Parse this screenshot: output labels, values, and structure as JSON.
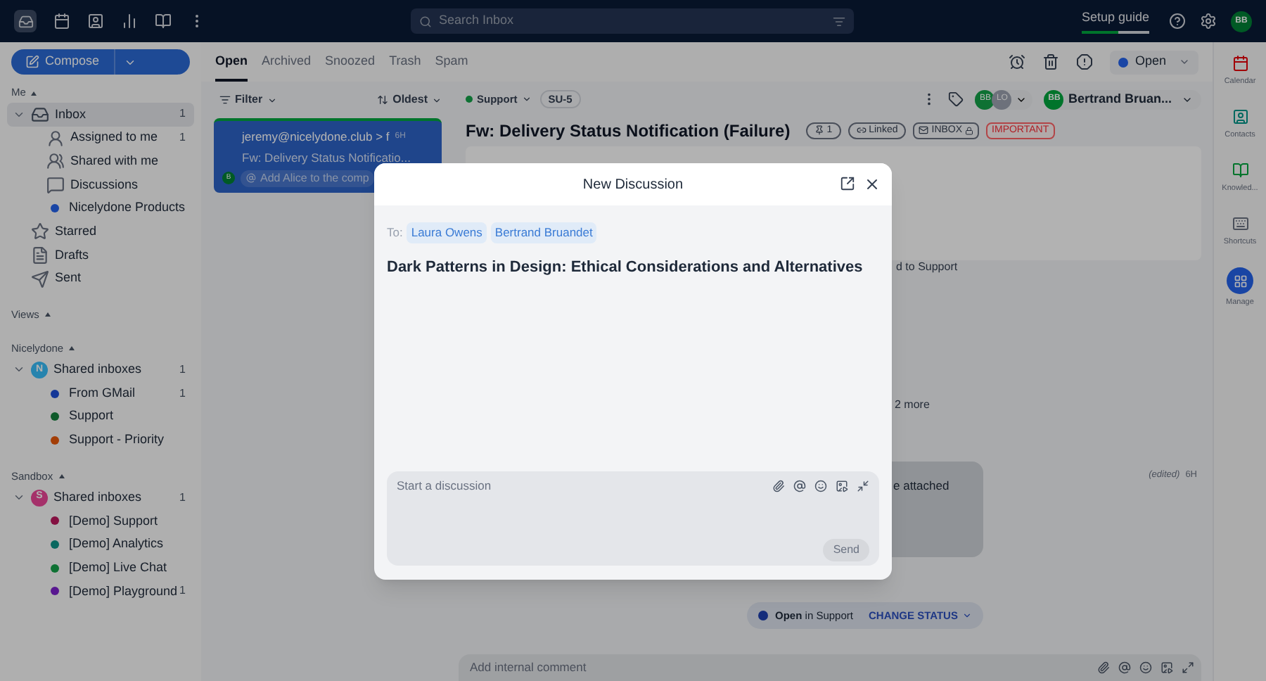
{
  "top_bar": {
    "search": {
      "placeholder": "Search Inbox"
    },
    "setup_guide": {
      "label": "Setup guide",
      "level": 0.55
    },
    "avatar": "BB"
  },
  "sidebar": {
    "compose": "Compose",
    "sections": [
      {
        "title": "Me",
        "items": [
          {
            "kind": "inbox",
            "label": "Inbox",
            "count": "1",
            "selected": true,
            "expanded": true,
            "children": [
              {
                "kind": "person",
                "label": "Assigned to me",
                "count": "1",
                "selected": false
              },
              {
                "kind": "people",
                "label": "Shared with me",
                "selected": false
              },
              {
                "kind": "chat",
                "label": "Discussions",
                "selected": false
              },
              {
                "kind": "dot",
                "label": "Nicelydone Products",
                "color": "#1a45a5",
                "selected": false
              }
            ]
          },
          {
            "kind": "star",
            "label": "Starred",
            "selected": false
          },
          {
            "kind": "draft",
            "label": "Drafts",
            "selected": false
          },
          {
            "kind": "send",
            "label": "Sent",
            "selected": false
          }
        ]
      },
      {
        "title": "Views"
      },
      {
        "title": "Nicelydone",
        "items": [
          {
            "kind": "group",
            "badge": "N",
            "color": "#2784ae",
            "label": "Shared inboxes",
            "count": "1",
            "selected": false,
            "expanded": true,
            "children": [
              {
                "kind": "dot",
                "label": "From GMail",
                "count": "1",
                "color": "#143797",
                "selected": false
              },
              {
                "kind": "dot",
                "label": "Support",
                "color": "#0f5a2b",
                "selected": false
              },
              {
                "kind": "dot",
                "label": "Support - Priority",
                "color": "#a43e08",
                "selected": false
              }
            ]
          }
        ]
      },
      {
        "title": "Sandbox",
        "items": [
          {
            "kind": "group",
            "badge": "S",
            "color": "#a5326b",
            "label": "Shared inboxes",
            "count": "1",
            "selected": false,
            "expanded": true,
            "children": [
              {
                "kind": "dot",
                "label": "[Demo] Support",
                "color": "#851141",
                "selected": false
              },
              {
                "kind": "dot",
                "label": "[Demo] Analytics",
                "color": "#09685f",
                "selected": false
              },
              {
                "kind": "dot",
                "label": "[Demo] Live Chat",
                "color": "#0f7234",
                "selected": false
              },
              {
                "kind": "dot",
                "label": "[Demo] Playground",
                "count": "1",
                "color": "#581890",
                "selected": false
              }
            ]
          }
        ]
      }
    ]
  },
  "tabs": [
    {
      "label": "Open",
      "selected": true
    },
    {
      "label": "Archived",
      "selected": false
    },
    {
      "label": "Snoozed",
      "selected": false
    },
    {
      "label": "Trash",
      "selected": false
    },
    {
      "label": "Spam",
      "selected": false
    }
  ],
  "status_menu": {
    "label": "Open",
    "color": "#1a45a5"
  },
  "list_toolbar": {
    "filter": "Filter",
    "sort": "Oldest"
  },
  "conversations": [
    {
      "from": "jeremy@nicelydone.club > f",
      "time": "6H",
      "subject": "Fw: Delivery Status Notificatio...",
      "comment": "Add Alice to the comp",
      "avatar": "B",
      "selected": true
    }
  ],
  "detail": {
    "inbox": {
      "label": "Support",
      "color": "#0f7234"
    },
    "ticket": "SU-5",
    "assignees": [
      {
        "initials": "BB",
        "color": "#0f7234"
      },
      {
        "initials": "LO",
        "color": "#6d727b"
      }
    ],
    "assignee": {
      "initials": "BB",
      "name": "Bertrand Bruan..."
    },
    "title": "Fw: Delivery Status Notification (Failure)",
    "tags": [
      {
        "kind": "pin",
        "text": "1"
      },
      {
        "kind": "linked",
        "text": "Linked"
      },
      {
        "kind": "inbox",
        "text": "INBOX"
      },
      {
        "kind": "important",
        "text": "IMPORTANT"
      }
    ],
    "fragment_1": "d to Support",
    "fragment_2": "2 more",
    "fragment_3": "e attached",
    "edited": "(edited)",
    "time": "6H",
    "status": {
      "state": "Open",
      "place": "in Support",
      "action": "CHANGE STATUS",
      "color": "#152d7b"
    },
    "comment": {
      "placeholder": "Add internal comment"
    }
  },
  "right_rail": [
    {
      "kind": "calendar",
      "label": "Calendar"
    },
    {
      "kind": "contacts",
      "label": "Contacts"
    },
    {
      "kind": "knowledge",
      "label": "Knowled..."
    },
    {
      "kind": "shortcuts",
      "label": "Shortcuts"
    },
    {
      "kind": "manage",
      "label": "Manage"
    }
  ],
  "modal": {
    "title": "New Discussion",
    "to_label": "To:",
    "recipients": [
      "Laura Owens",
      "Bertrand Bruandet"
    ],
    "subject": "Dark Patterns in Design: Ethical Considerations and Alternatives",
    "composer": {
      "placeholder": "Start a discussion"
    },
    "send": "Send"
  }
}
